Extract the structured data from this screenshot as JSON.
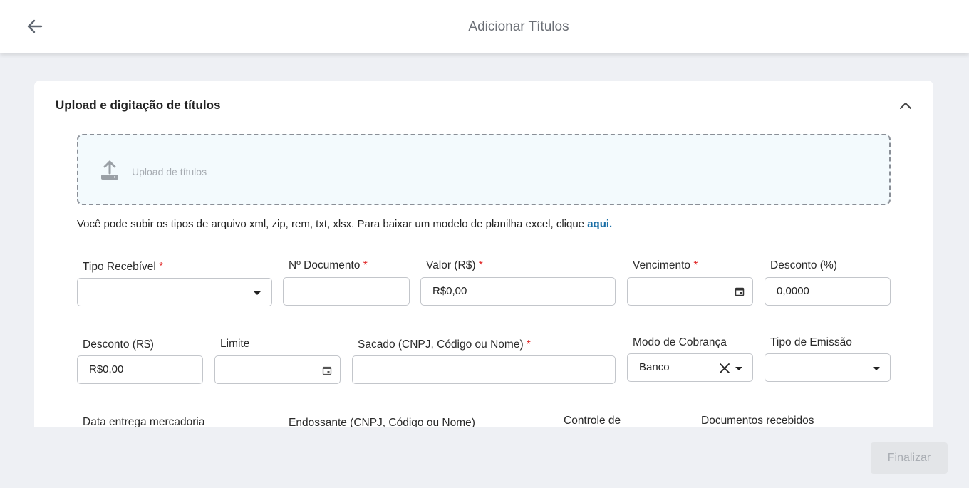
{
  "header": {
    "title": "Adicionar Títulos",
    "back_icon": "arrow-left-icon"
  },
  "section": {
    "title": "Upload e digitação de títulos",
    "collapse_icon": "chevron-up-icon"
  },
  "upload": {
    "label": "Upload de títulos",
    "icon": "upload-icon",
    "hint_text": "Você pode subir os tipos de arquivo xml, zip, rem, txt, xlsx. Para baixar um modelo de planilha excel, clique ",
    "hint_link": "aqui."
  },
  "form": {
    "tipo_recebivel": {
      "label": "Tipo Recebível",
      "required": "*",
      "value": ""
    },
    "n_documento": {
      "label": "Nº Documento",
      "required": "*",
      "value": ""
    },
    "valor": {
      "label": "Valor (R$)",
      "required": "*",
      "value": "R$0,00"
    },
    "vencimento": {
      "label": "Vencimento",
      "required": "*",
      "value": ""
    },
    "desconto_pct": {
      "label": "Desconto (%)",
      "value": "0,0000"
    },
    "desconto_rs": {
      "label": "Desconto (R$)",
      "value": "R$0,00"
    },
    "limite": {
      "label": "Limite",
      "value": ""
    },
    "sacado": {
      "label": "Sacado (CNPJ, Código ou Nome)",
      "required": "*",
      "value": ""
    },
    "modo_cobranca": {
      "label": "Modo de Cobrança",
      "value": "Banco"
    },
    "tipo_emissao": {
      "label": "Tipo de Emissão",
      "value": ""
    },
    "data_entrega": {
      "label": "Data entrega mercadoria"
    },
    "endossante": {
      "label": "Endossante (CNPJ, Código ou Nome)"
    },
    "controle": {
      "label": "Controle de"
    },
    "documentos": {
      "label": "Documentos recebidos"
    }
  },
  "footer": {
    "finish_label": "Finalizar"
  },
  "colors": {
    "accent_link": "#1b6fa6",
    "required": "#e02424",
    "dropzone_bg": "#f3fafd",
    "page_bg": "#eef0f4"
  }
}
